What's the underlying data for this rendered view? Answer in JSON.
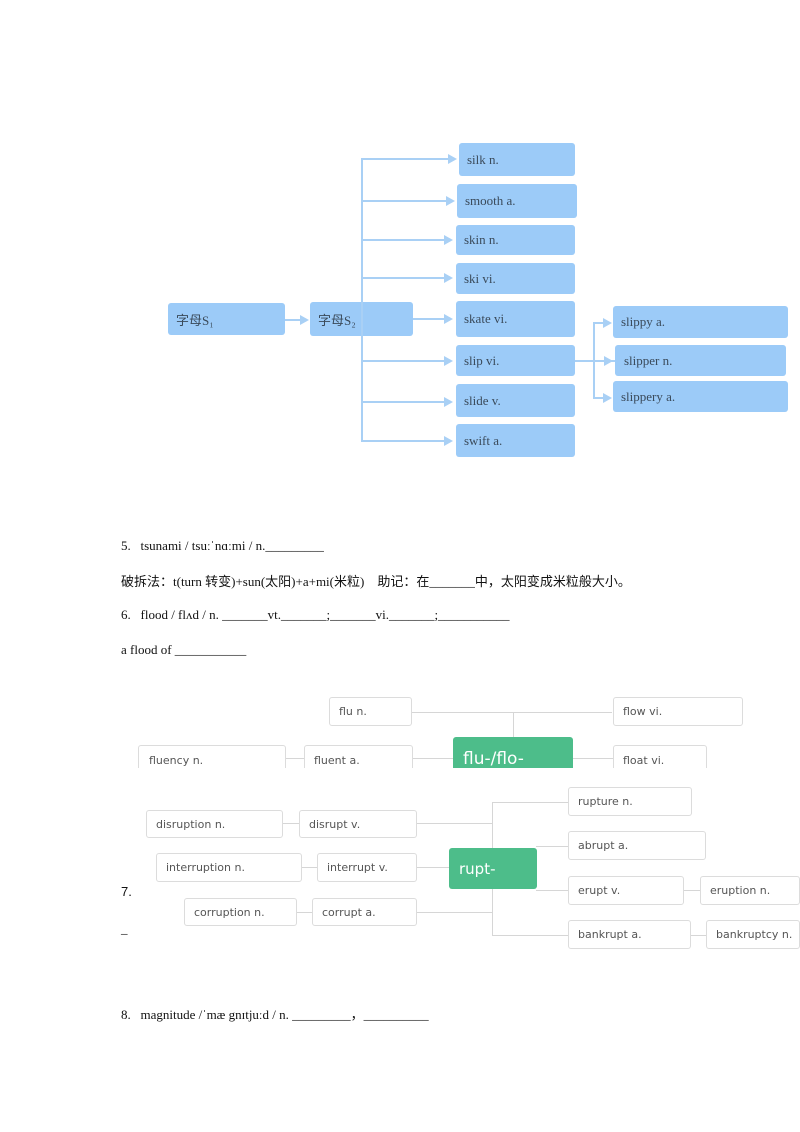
{
  "diagram_s": {
    "root1": "字母S₁",
    "root2": "字母S₂",
    "branches": [
      "silk n.",
      "smooth a.",
      "skin n.",
      "ski vi.",
      "skate vi.",
      "slip vi.",
      "slide v.",
      "swift a."
    ],
    "slip_children": [
      "slippy a.",
      "slipper n.",
      "slippery a."
    ]
  },
  "items": {
    "item5": "5.   tsunami / tsuːˈnɑːmi / n._________",
    "item5_note": "破拆法：t(turn 转变)+sun(太阳)+a+mi(米粒)    助记：在_______中，太阳变成米粒般大小。",
    "item6": "6.   flood / flʌd / n. _______vt._______;_______vi._______;___________",
    "item6_phrase": "a flood of ___________",
    "item7_number": "7.",
    "item7_blank": "_",
    "item8": "8.   magnitude /ˈmæ gnɪtjuːd / n. _________，__________"
  },
  "diagram_flu": {
    "center": "flu-/flo-",
    "nodes": [
      "flu n.",
      "flow vi.",
      "fluency n.",
      "fluent a.",
      "float vi."
    ]
  },
  "diagram_rupt": {
    "center": "rupt-",
    "left": [
      {
        "word": "disrupt v.",
        "derived": "disruption n."
      },
      {
        "word": "interrupt v.",
        "derived": "interruption n."
      },
      {
        "word": "corrupt a.",
        "derived": "corruption n."
      }
    ],
    "right": [
      {
        "word": "rupture n.",
        "derived": null
      },
      {
        "word": "abrupt a.",
        "derived": null
      },
      {
        "word": "erupt v.",
        "derived": "eruption n."
      },
      {
        "word": "bankrupt a.",
        "derived": "bankruptcy n."
      }
    ]
  },
  "colors": {
    "blue_box": "#9ccbf8",
    "green_center": "#4dbd8a"
  }
}
